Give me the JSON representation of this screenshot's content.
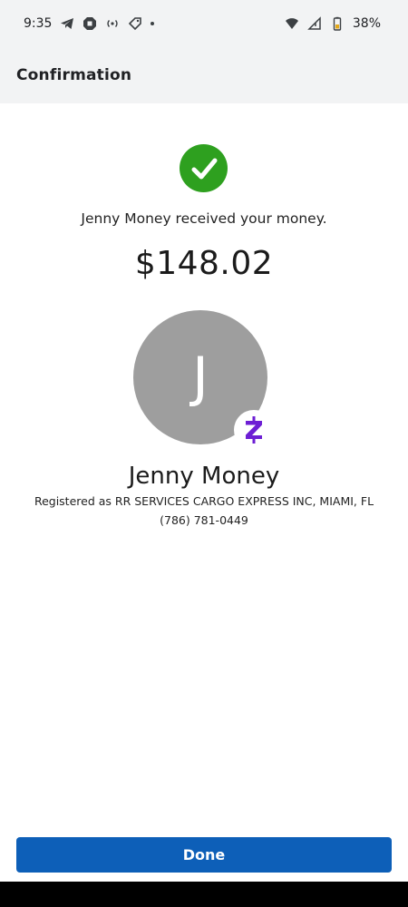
{
  "status_bar": {
    "time": "9:35",
    "battery": "38%",
    "left_icons": [
      "telegram-icon",
      "chase-icon",
      "hotspot-icon",
      "tag-icon",
      "dot-icon"
    ],
    "right_icons": [
      "wifi-icon",
      "signal-icon",
      "battery-icon"
    ]
  },
  "header": {
    "title": "Confirmation"
  },
  "confirmation": {
    "message": "Jenny Money received your money.",
    "amount": "$148.02",
    "status_color": "#2ea01f"
  },
  "recipient": {
    "initial": "J",
    "name": "Jenny Money",
    "registered": "Registered as RR SERVICES CARGO EXPRESS INC, MIAMI, FL",
    "phone": "(786) 781-0449",
    "avatar_color": "#9e9e9e",
    "badge_icon": "zelle-icon",
    "badge_color": "#6d1ed4"
  },
  "actions": {
    "done_label": "Done",
    "done_color": "#0d5fb8"
  }
}
